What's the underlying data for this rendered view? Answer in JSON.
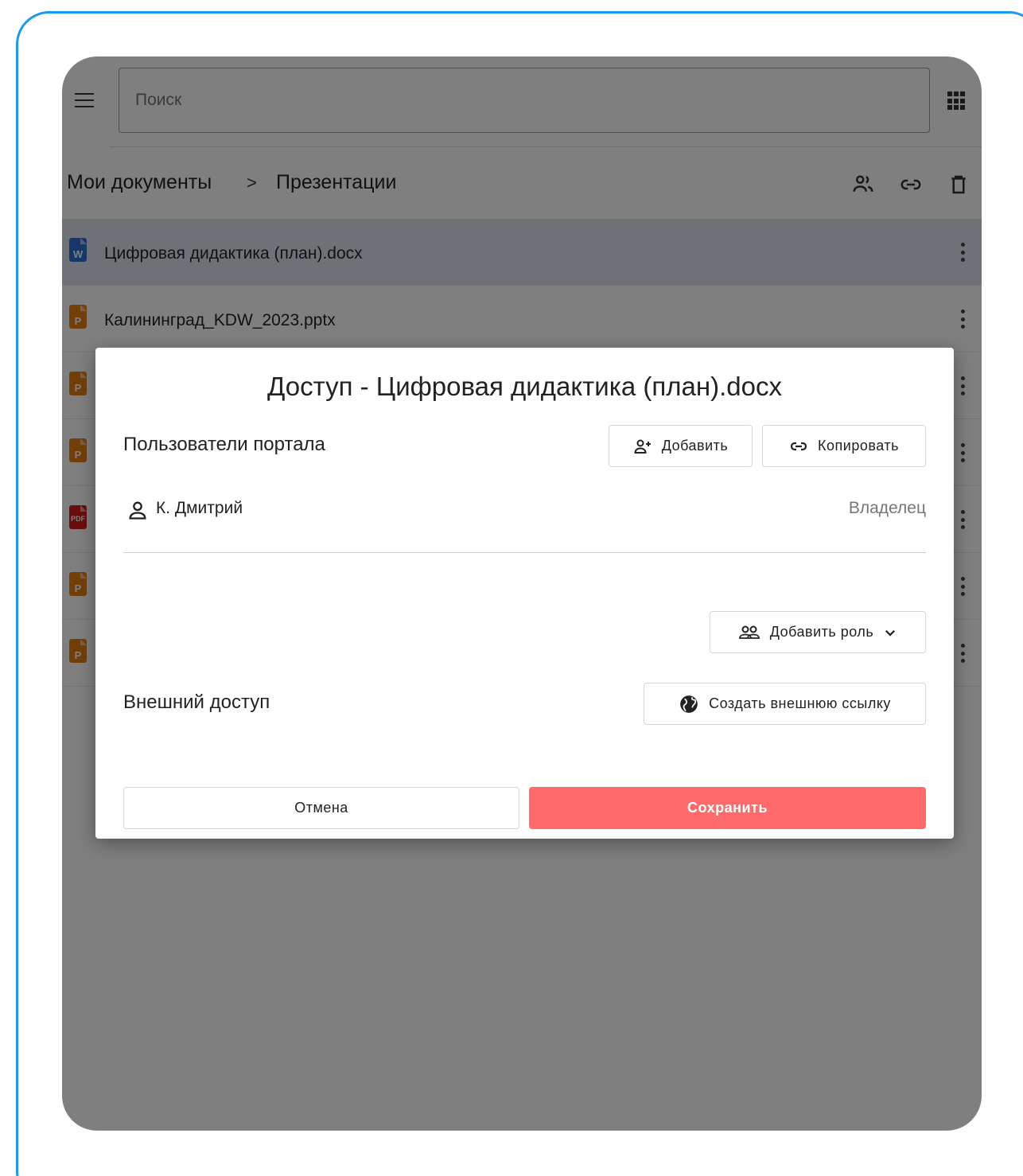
{
  "search": {
    "placeholder": "Поиск"
  },
  "breadcrumb": {
    "items": [
      "Мои документы",
      "Презентации"
    ],
    "separator": ">"
  },
  "toolbar": {
    "icons": [
      "people-icon",
      "link-icon",
      "trash-icon"
    ]
  },
  "files": [
    {
      "name": "Цифровая дидактика (план).docx",
      "type": "docx",
      "icon_letter": "W",
      "selected": true
    },
    {
      "name": "Калининград_KDW_2023.pptx",
      "type": "pptx",
      "icon_letter": "P",
      "selected": false
    },
    {
      "name": "",
      "type": "pptx",
      "icon_letter": "P",
      "selected": false
    },
    {
      "name": "",
      "type": "pptx",
      "icon_letter": "P",
      "selected": false
    },
    {
      "name": "",
      "type": "pdf",
      "icon_letter": "PDF",
      "selected": false
    },
    {
      "name": "",
      "type": "pptx",
      "icon_letter": "P",
      "selected": false
    },
    {
      "name": "",
      "type": "pptx",
      "icon_letter": "P",
      "selected": false
    }
  ],
  "dialog": {
    "title": "Доступ - Цифровая дидактика (план).docx",
    "portal_users_label": "Пользователи портала",
    "add_button": "Добавить",
    "copy_button": "Копировать",
    "user": {
      "name": "К. Дмитрий",
      "role": "Владелец"
    },
    "add_role_button": "Добавить роль",
    "external_access_label": "Внешний доступ",
    "create_link_button": "Создать внешнюю ссылку",
    "cancel_button": "Отмена",
    "save_button": "Сохранить"
  },
  "colors": {
    "accent": "#ff6b6b",
    "frame": "#1a9af0",
    "docx": "#2d6fcf",
    "pptx": "#e67e13",
    "pdf": "#d61a1a"
  }
}
